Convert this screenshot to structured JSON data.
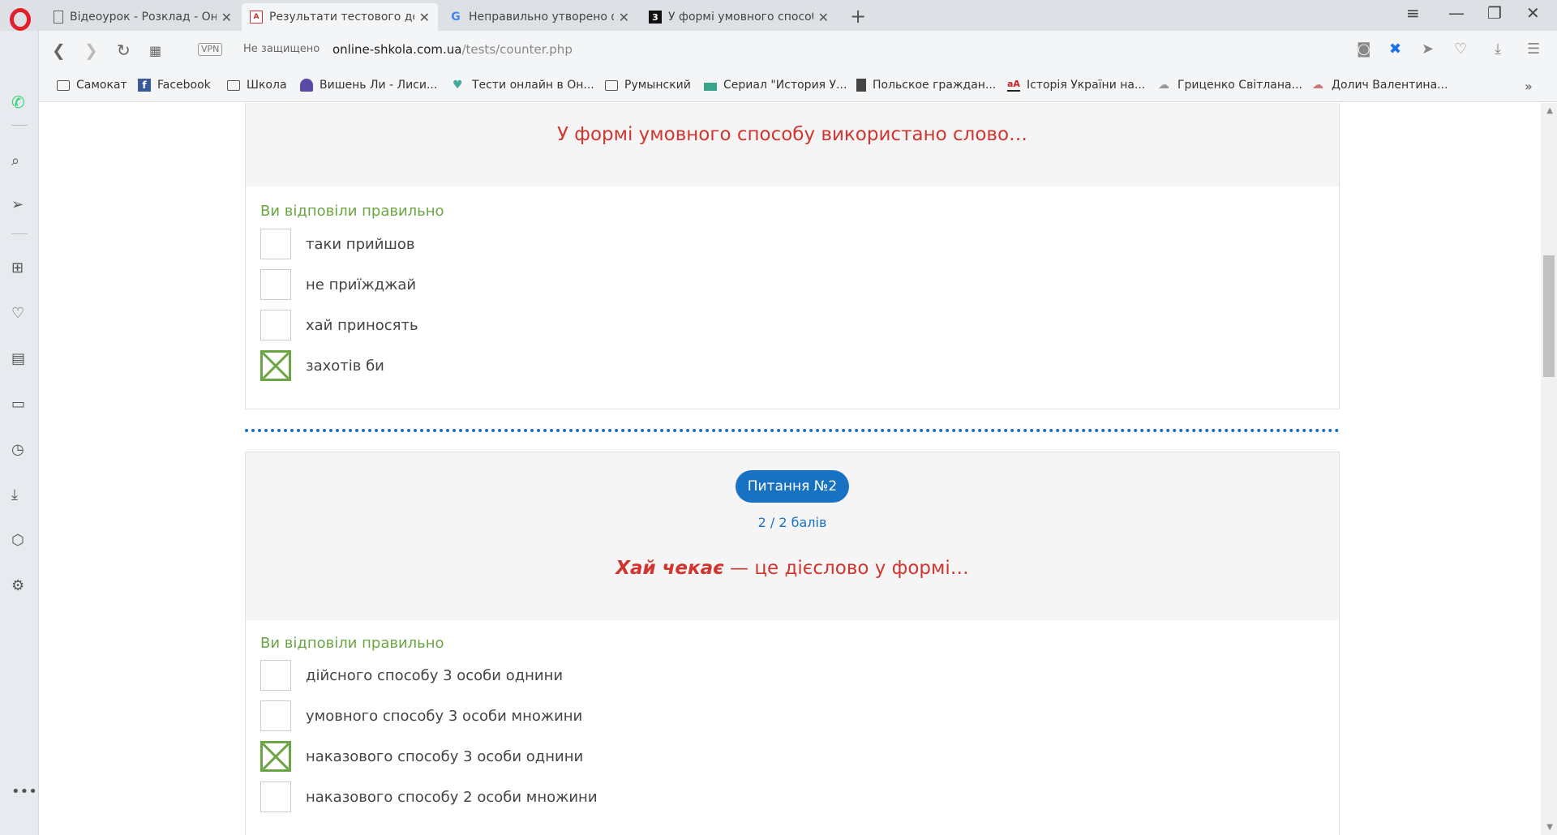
{
  "browser": {
    "tabs": [
      {
        "label": "Відеоурок - Розклад - Онлайн",
        "favicon": "doc-icon"
      },
      {
        "label": "Результати тестового домашнього",
        "favicon": "pdf-icon"
      },
      {
        "label": "Неправильно утворено форму",
        "favicon": "google-icon"
      },
      {
        "label": "У формі умовного способу",
        "favicon": "3-icon"
      }
    ],
    "vpn_label": "VPN",
    "security_label": "Не защищено",
    "url_host": "online-shkola.com.ua",
    "url_path": "/tests/counter.php"
  },
  "bookmarks": [
    {
      "label": "Самокат"
    },
    {
      "label": "Facebook"
    },
    {
      "label": "Школа"
    },
    {
      "label": "Вишень Ли - Лиси..."
    },
    {
      "label": "Тести онлайн в Он..."
    },
    {
      "label": "Румынский"
    },
    {
      "label": "Сериал \"История У..."
    },
    {
      "label": "Польское граждан..."
    },
    {
      "label": "Історія України на..."
    },
    {
      "label": "Гриценко Світлана..."
    },
    {
      "label": "Долич Валентина..."
    }
  ],
  "question1": {
    "text": "У формі умовного способу використано слово…",
    "result": "Ви відповіли правильно",
    "options": [
      {
        "label": "таки прийшов",
        "checked": false
      },
      {
        "label": "не приїжджай",
        "checked": false
      },
      {
        "label": "хай приносять",
        "checked": false
      },
      {
        "label": "захотів би",
        "checked": true
      }
    ]
  },
  "question2": {
    "badge": "Питання №2",
    "points": "2 / 2 балів",
    "text_emphasis": "Хай чекає",
    "text_rest": " — це дієслово у формі…",
    "result": "Ви відповіли правильно",
    "options": [
      {
        "label": "дійсного способу 3 особи однини",
        "checked": false
      },
      {
        "label": "умовного способу 3 особи множини",
        "checked": false
      },
      {
        "label": "наказового способу 3 особи однини",
        "checked": true
      },
      {
        "label": "наказового способу 2 особи множини",
        "checked": false
      }
    ]
  },
  "colors": {
    "question_red": "#d0362f",
    "correct_green": "#6ba644",
    "accent_blue": "#1872c4"
  }
}
